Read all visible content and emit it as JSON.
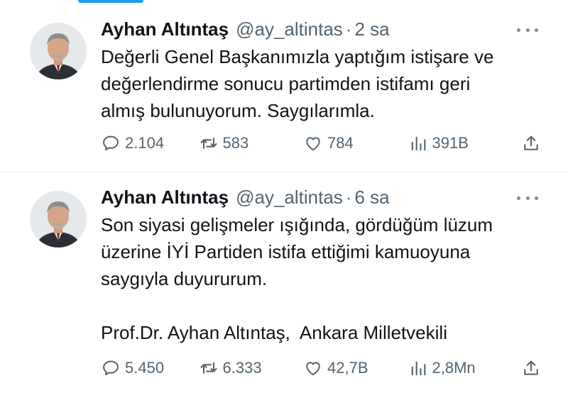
{
  "tweets": [
    {
      "author_name": "Ayhan Altıntaş",
      "handle": "@ay_altintas",
      "separator": "·",
      "time": "2 sa",
      "text_lines": [
        "Değerli Genel Başkanımızla yaptığım istişare ve",
        "değerlendirme sonucu partimden istifamı geri",
        "almış bulunuyorum. Saygılarımla."
      ],
      "replies": "2.104",
      "retweets": "583",
      "likes": "784",
      "views": "391B"
    },
    {
      "author_name": "Ayhan Altıntaş",
      "handle": "@ay_altintas",
      "separator": "·",
      "time": "6 sa",
      "text_lines": [
        "Son siyasi gelişmeler ışığında, gördüğüm lüzum",
        "üzerine İYİ Partiden istifa ettiğimi kamuoyuna",
        "saygıyla duyururum."
      ],
      "signature": "Prof.Dr. Ayhan Altıntaş,  Ankara Milletvekili",
      "replies": "5.450",
      "retweets": "6.333",
      "likes": "42,7B",
      "views": "2,8Mn"
    }
  ],
  "icons": {
    "more": "more-horizontal-icon",
    "reply": "reply-bubble-icon",
    "retweet": "retweet-icon",
    "like": "heart-icon",
    "views": "views-chart-icon",
    "share": "share-icon"
  },
  "colors": {
    "text": "#0f1419",
    "secondary": "#536471",
    "accent": "#1d9bf0",
    "divider": "#eff3f4"
  }
}
